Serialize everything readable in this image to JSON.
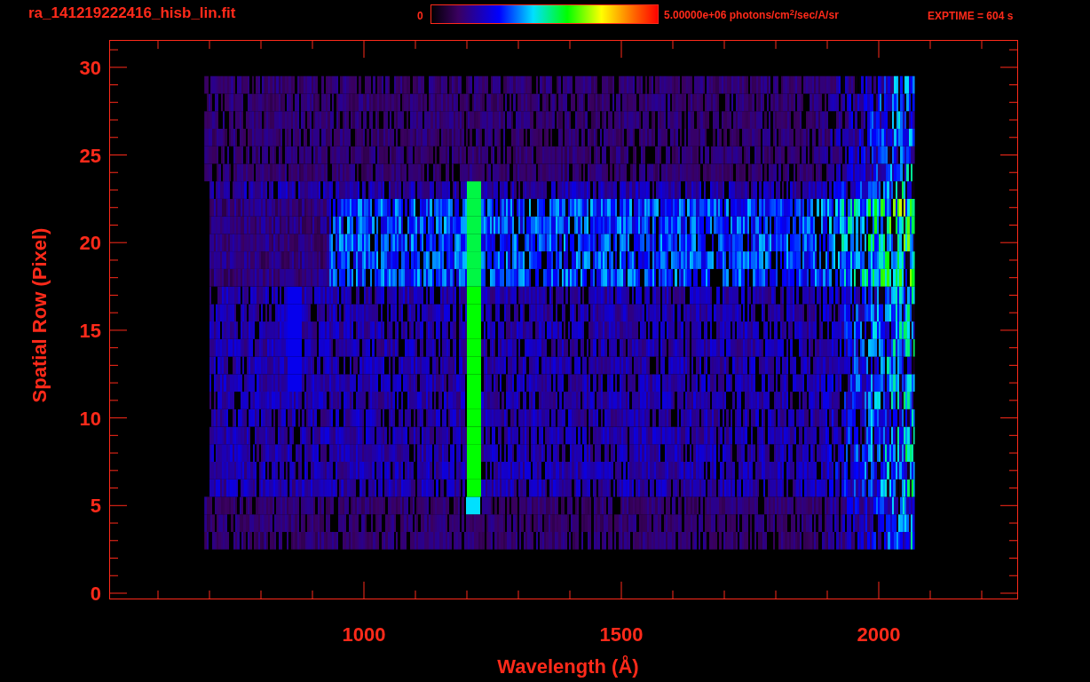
{
  "title": "ra_141219222416_hisb_lin.fit",
  "colorbar": {
    "min_label": "0",
    "max_label": "5.00000e+06 photons/cm$^{2}$/sec/A/sr"
  },
  "exptime": "EXPTIME = 604 s",
  "plot": {
    "xlabel": "Wavelength (Å)",
    "ylabel": "Spatial Row (Pixel)",
    "xtick_labels": [
      "1000",
      "1500",
      "2000"
    ],
    "ytick_labels": [
      "30",
      "25",
      "20",
      "15",
      "10",
      "5",
      "0"
    ]
  }
}
